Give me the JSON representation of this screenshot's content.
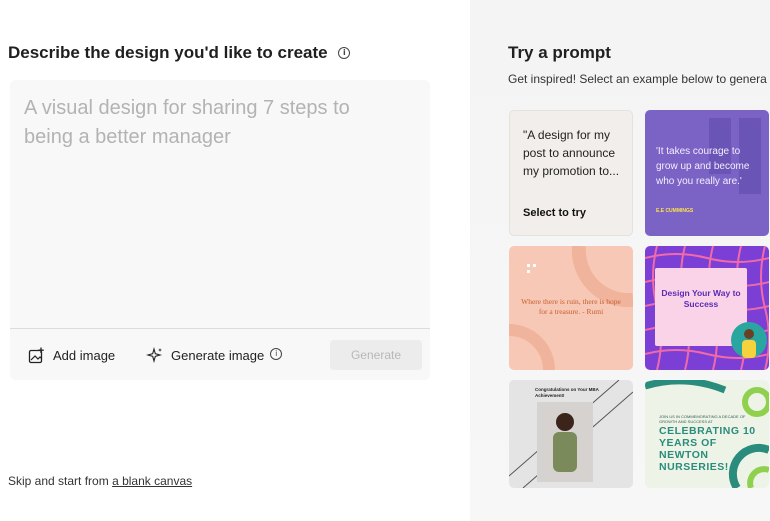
{
  "left": {
    "heading": "Describe the design you'd like to create",
    "info_icon": "i",
    "prompt_placeholder": "A visual design for sharing 7 steps to being a better manager",
    "toolbar": {
      "add_image_label": "Add image",
      "generate_image_label": "Generate image",
      "generate_button_label": "Generate"
    },
    "skip_text": "Skip and start from",
    "blank_canvas_link": "a blank canvas"
  },
  "right": {
    "title": "Try a prompt",
    "subtitle": "Get inspired! Select an example below to genera",
    "cards": [
      {
        "quote": "\"A design for my post to announce my promotion to...",
        "cta": "Select to try"
      },
      {
        "quote": "'It takes courage to grow up and become who you really are.'",
        "author": "E.E CUMMINGS"
      },
      {
        "quote": "Where there is ruin, there is hope for a treasure. - Rumi"
      },
      {
        "title": "Design Your Way to Success"
      },
      {
        "title": "Congratulations on Your MBA Achievement!"
      },
      {
        "small": "JOIN US IN COMMEMORATING A DECADE OF GROWTH AND SUCCESS AT",
        "title": "CELEBRATING 10 YEARS OF NEWTON NURSERIES!"
      }
    ]
  },
  "colors": {
    "accent_purple": "#7a63c4",
    "card_peach": "#f7c8b5",
    "card_violet": "#7b3fd6",
    "teal": "#2a8c7c",
    "placeholder_gray": "#b3b3b3"
  },
  "icons": [
    "info-icon",
    "add-image-icon",
    "sparkle-icon"
  ]
}
